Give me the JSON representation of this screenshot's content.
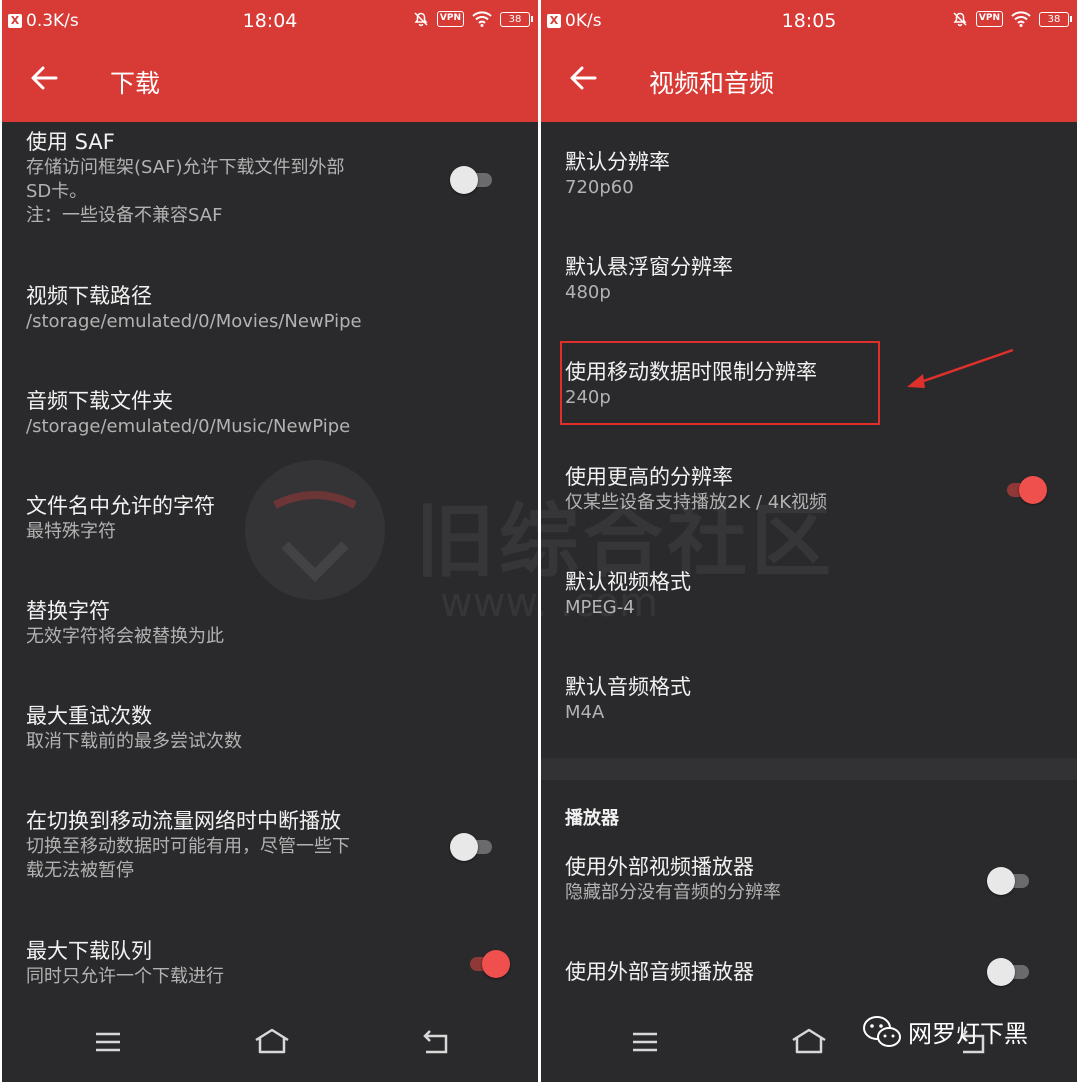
{
  "left_screen": {
    "status": {
      "net_speed": "0.3K/s",
      "time": "18:04",
      "vpn": "VPN",
      "battery": "38"
    },
    "appbar": {
      "title": "下载"
    },
    "prefs": [
      {
        "title": "使用 SAF",
        "summary_lines": [
          "存储访问框架(SAF)允许下载文件到外部",
          "SD卡。",
          "注：一些设备不兼容SAF"
        ],
        "toggle": "off"
      },
      {
        "title": "视频下载路径",
        "summary_lines": [
          "/storage/emulated/0/Movies/NewPipe"
        ]
      },
      {
        "title": "音频下载文件夹",
        "summary_lines": [
          "/storage/emulated/0/Music/NewPipe"
        ]
      },
      {
        "title": "文件名中允许的字符",
        "summary_lines": [
          "最特殊字符"
        ]
      },
      {
        "title": "替换字符",
        "summary_lines": [
          "无效字符将会被替换为此"
        ]
      },
      {
        "title": "最大重试次数",
        "summary_lines": [
          "取消下载前的最多尝试次数"
        ]
      },
      {
        "title": "在切换到移动流量网络时中断播放",
        "summary_lines": [
          "切换至移动数据时可能有用，尽管一些下",
          "载无法被暂停"
        ],
        "toggle": "off"
      },
      {
        "title": "最大下载队列",
        "summary_lines": [
          "同时只允许一个下载进行"
        ],
        "toggle": "on"
      }
    ]
  },
  "right_screen": {
    "status": {
      "net_speed": "0K/s",
      "time": "18:05",
      "vpn": "VPN",
      "battery": "38"
    },
    "appbar": {
      "title": "视频和音频"
    },
    "prefs": [
      {
        "title": "默认分辨率",
        "summary_lines": [
          "720p60"
        ]
      },
      {
        "title": "默认悬浮窗分辨率",
        "summary_lines": [
          "480p"
        ]
      },
      {
        "title": "使用移动数据时限制分辨率",
        "summary_lines": [
          "240p"
        ],
        "highlighted": true
      },
      {
        "title": "使用更高的分辨率",
        "summary_lines": [
          "仅某些设备支持播放2K / 4K视频"
        ],
        "toggle": "on"
      },
      {
        "title": "默认视频格式",
        "summary_lines": [
          "MPEG-4"
        ]
      },
      {
        "title": "默认音频格式",
        "summary_lines": [
          "M4A"
        ]
      }
    ],
    "category": "播放器",
    "player_prefs": [
      {
        "title": "使用外部视频播放器",
        "summary_lines": [
          "隐藏部分没有音频的分辨率"
        ],
        "toggle": "off"
      },
      {
        "title": "使用外部音频播放器",
        "summary_lines": [],
        "toggle": "off"
      }
    ]
  },
  "watermark": {
    "line1": "旧综合社区",
    "line2": "www.          .com"
  },
  "credit": {
    "text": "网罗灯下黑"
  },
  "colors": {
    "accent": "#d83a36",
    "background": "#2a2a2c",
    "toggle_on": "#f0504d",
    "annotation": "#e0302c"
  },
  "icons": [
    "back-arrow-icon",
    "menu-icon",
    "home-icon",
    "return-icon",
    "wechat-icon",
    "vpn-icon",
    "wifi-icon",
    "battery-icon",
    "mute-icon"
  ]
}
